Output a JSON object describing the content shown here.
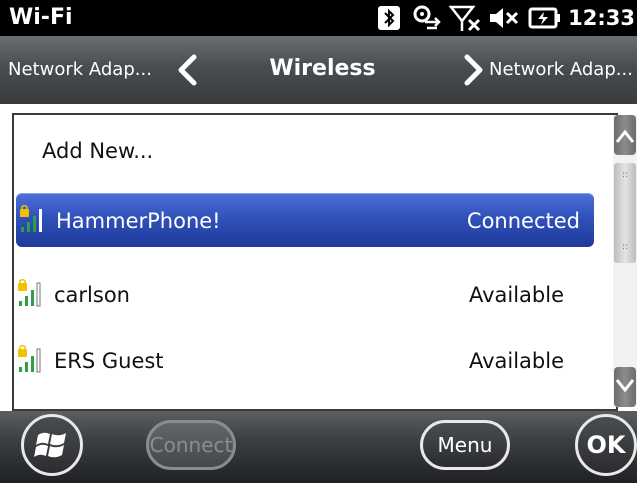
{
  "status_bar": {
    "app_title": "Wi-Fi",
    "clock": "12:33",
    "icons": [
      "bluetooth-icon",
      "connection-sync-icon",
      "signal-off-icon",
      "volume-muted-icon",
      "battery-charging-icon"
    ]
  },
  "header": {
    "prev_adapter": "Network Adap...",
    "title": "Wireless",
    "next_adapter": "Network Adap..."
  },
  "list": {
    "add_new": "Add New...",
    "networks": [
      {
        "name": "HammerPhone!",
        "status": "Connected",
        "selected": true,
        "secured": true
      },
      {
        "name": "carlson",
        "status": "Available",
        "selected": false,
        "secured": true
      },
      {
        "name": "ERS Guest",
        "status": "Available",
        "selected": false,
        "secured": true
      }
    ]
  },
  "toolbar": {
    "connect_label": "Connect",
    "menu_label": "Menu",
    "ok_label": "OK"
  },
  "colors": {
    "selection": "#2f4fb8",
    "signal_green": "#2ea043",
    "lock_yellow": "#f2c200",
    "header_bg": "#4a4d50"
  }
}
